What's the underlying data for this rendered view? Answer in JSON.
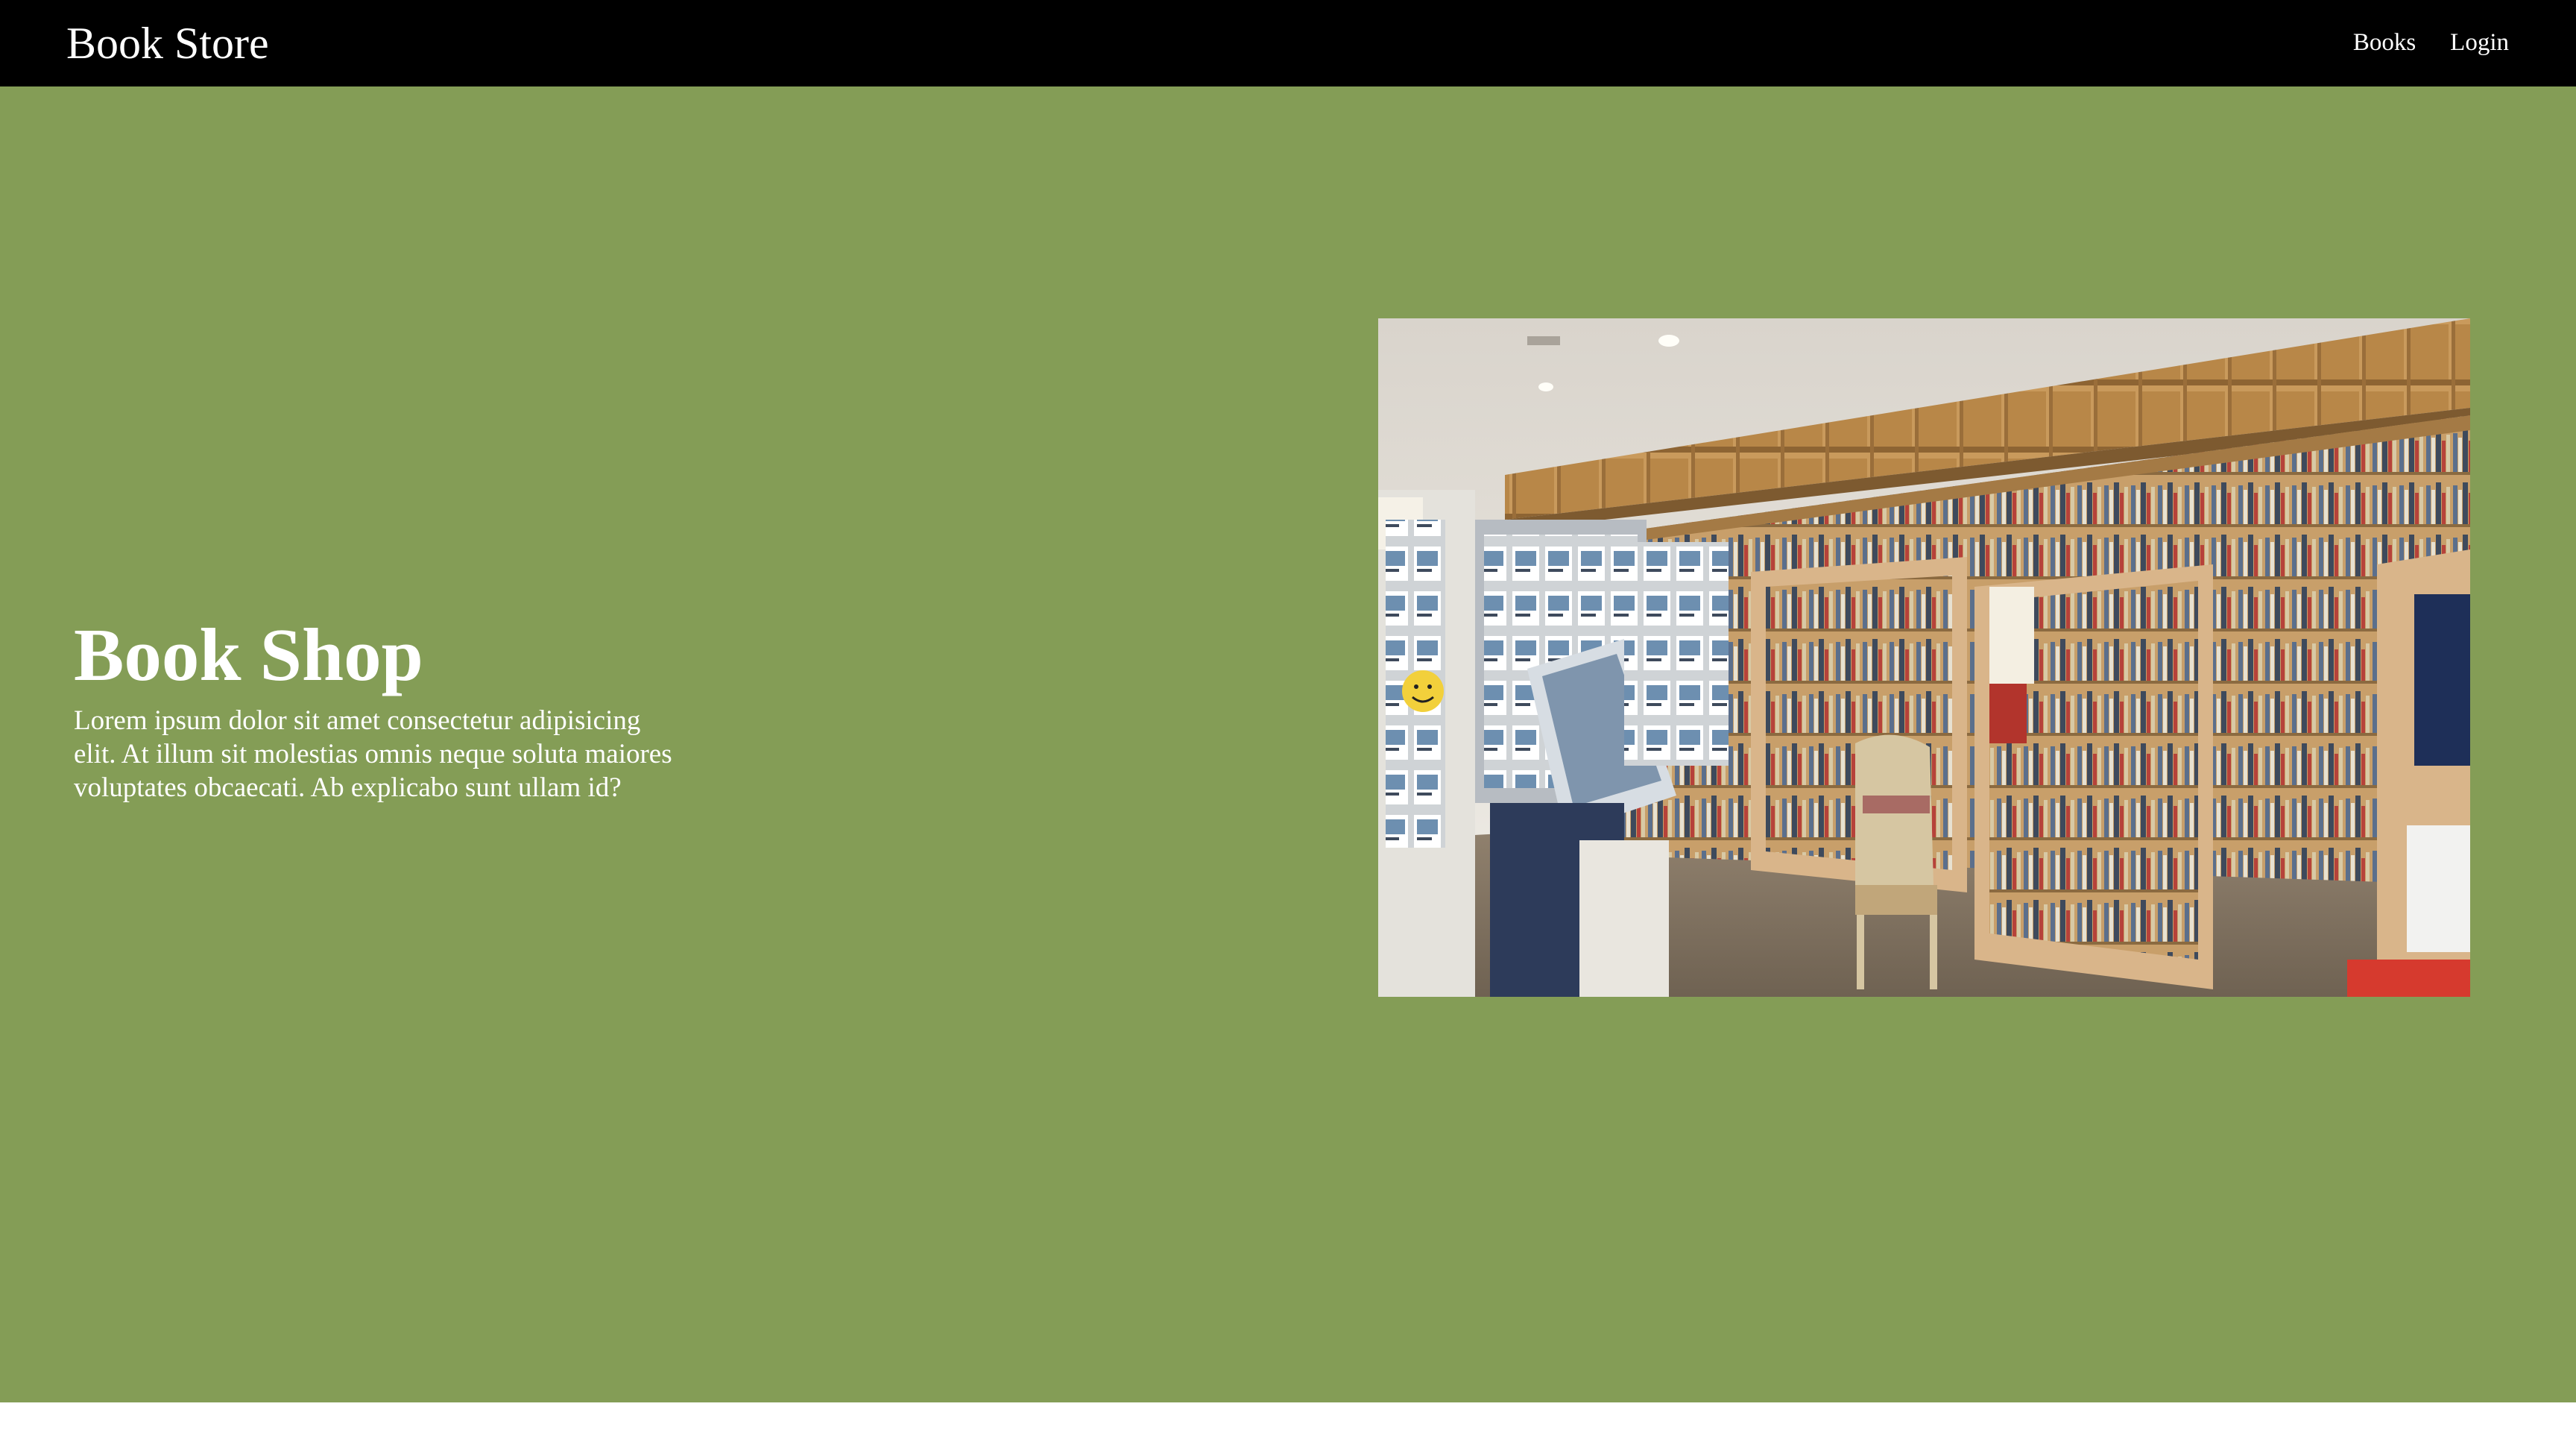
{
  "navbar": {
    "brand": "Book Store",
    "links": [
      {
        "label": "Books"
      },
      {
        "label": "Login"
      }
    ]
  },
  "hero": {
    "title": "Book Shop",
    "description": "Lorem ipsum dolor sit amet consectetur adipisicing elit. At illum sit molestias omnis neque soluta maiores voluptates obcaecati. Ab explicabo sunt ullam id?"
  },
  "colors": {
    "navbar_bg": "#000000",
    "hero_bg": "#849D56",
    "text": "#ffffff"
  }
}
